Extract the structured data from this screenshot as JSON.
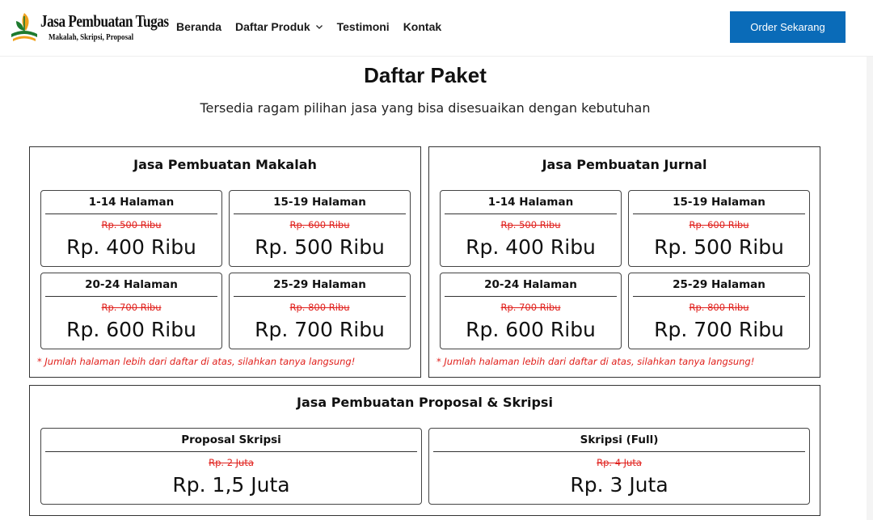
{
  "brand": {
    "title": "Jasa Pembuatan Tugas",
    "subtitle": "Makalah, Skripsi, Proposal"
  },
  "nav": [
    {
      "label": "Beranda"
    },
    {
      "label": "Daftar Produk",
      "has_dropdown": true
    },
    {
      "label": "Testimoni"
    },
    {
      "label": "Kontak"
    }
  ],
  "cta": {
    "label": "Order Sekarang"
  },
  "colors": {
    "accent": "#0a6bb8",
    "strike": "#e0201c",
    "border": "#333333"
  },
  "intro": {
    "title": "Daftar Paket",
    "subtitle": "Tersedia ragam pilihan jasa yang bisa disesuaikan dengan kebutuhan"
  },
  "sections": [
    {
      "title": "Jasa Pembuatan Makalah",
      "packages": [
        {
          "name": "1-14 Halaman",
          "old_price": "Rp. 500 Ribu",
          "price": "Rp. 400 Ribu"
        },
        {
          "name": "15-19 Halaman",
          "old_price": "Rp. 600 Ribu",
          "price": "Rp. 500 Ribu"
        },
        {
          "name": "20-24 Halaman",
          "old_price": "Rp. 700 Ribu",
          "price": "Rp. 600 Ribu"
        },
        {
          "name": "25-29 Halaman",
          "old_price": "Rp. 800 Ribu",
          "price": "Rp. 700 Ribu"
        }
      ],
      "note": "* Jumlah halaman lebih dari daftar di atas, silahkan tanya langsung!"
    },
    {
      "title": "Jasa Pembuatan Jurnal",
      "packages": [
        {
          "name": "1-14 Halaman",
          "old_price": "Rp. 500 Ribu",
          "price": "Rp. 400 Ribu"
        },
        {
          "name": "15-19 Halaman",
          "old_price": "Rp. 600 Ribu",
          "price": "Rp. 500 Ribu"
        },
        {
          "name": "20-24 Halaman",
          "old_price": "Rp. 700 Ribu",
          "price": "Rp. 600 Ribu"
        },
        {
          "name": "25-29 Halaman",
          "old_price": "Rp. 800 Ribu",
          "price": "Rp. 700 Ribu"
        }
      ],
      "note": "* Jumlah halaman lebih dari daftar di atas, silahkan tanya langsung!"
    },
    {
      "title": "Jasa Pembuatan Proposal & Skripsi",
      "packages": [
        {
          "name": "Proposal Skripsi",
          "old_price": "Rp. 2 Juta",
          "price": "Rp. 1,5 Juta"
        },
        {
          "name": "Skripsi (Full)",
          "old_price": "Rp. 4 Juta",
          "price": "Rp. 3 Juta"
        }
      ]
    }
  ]
}
